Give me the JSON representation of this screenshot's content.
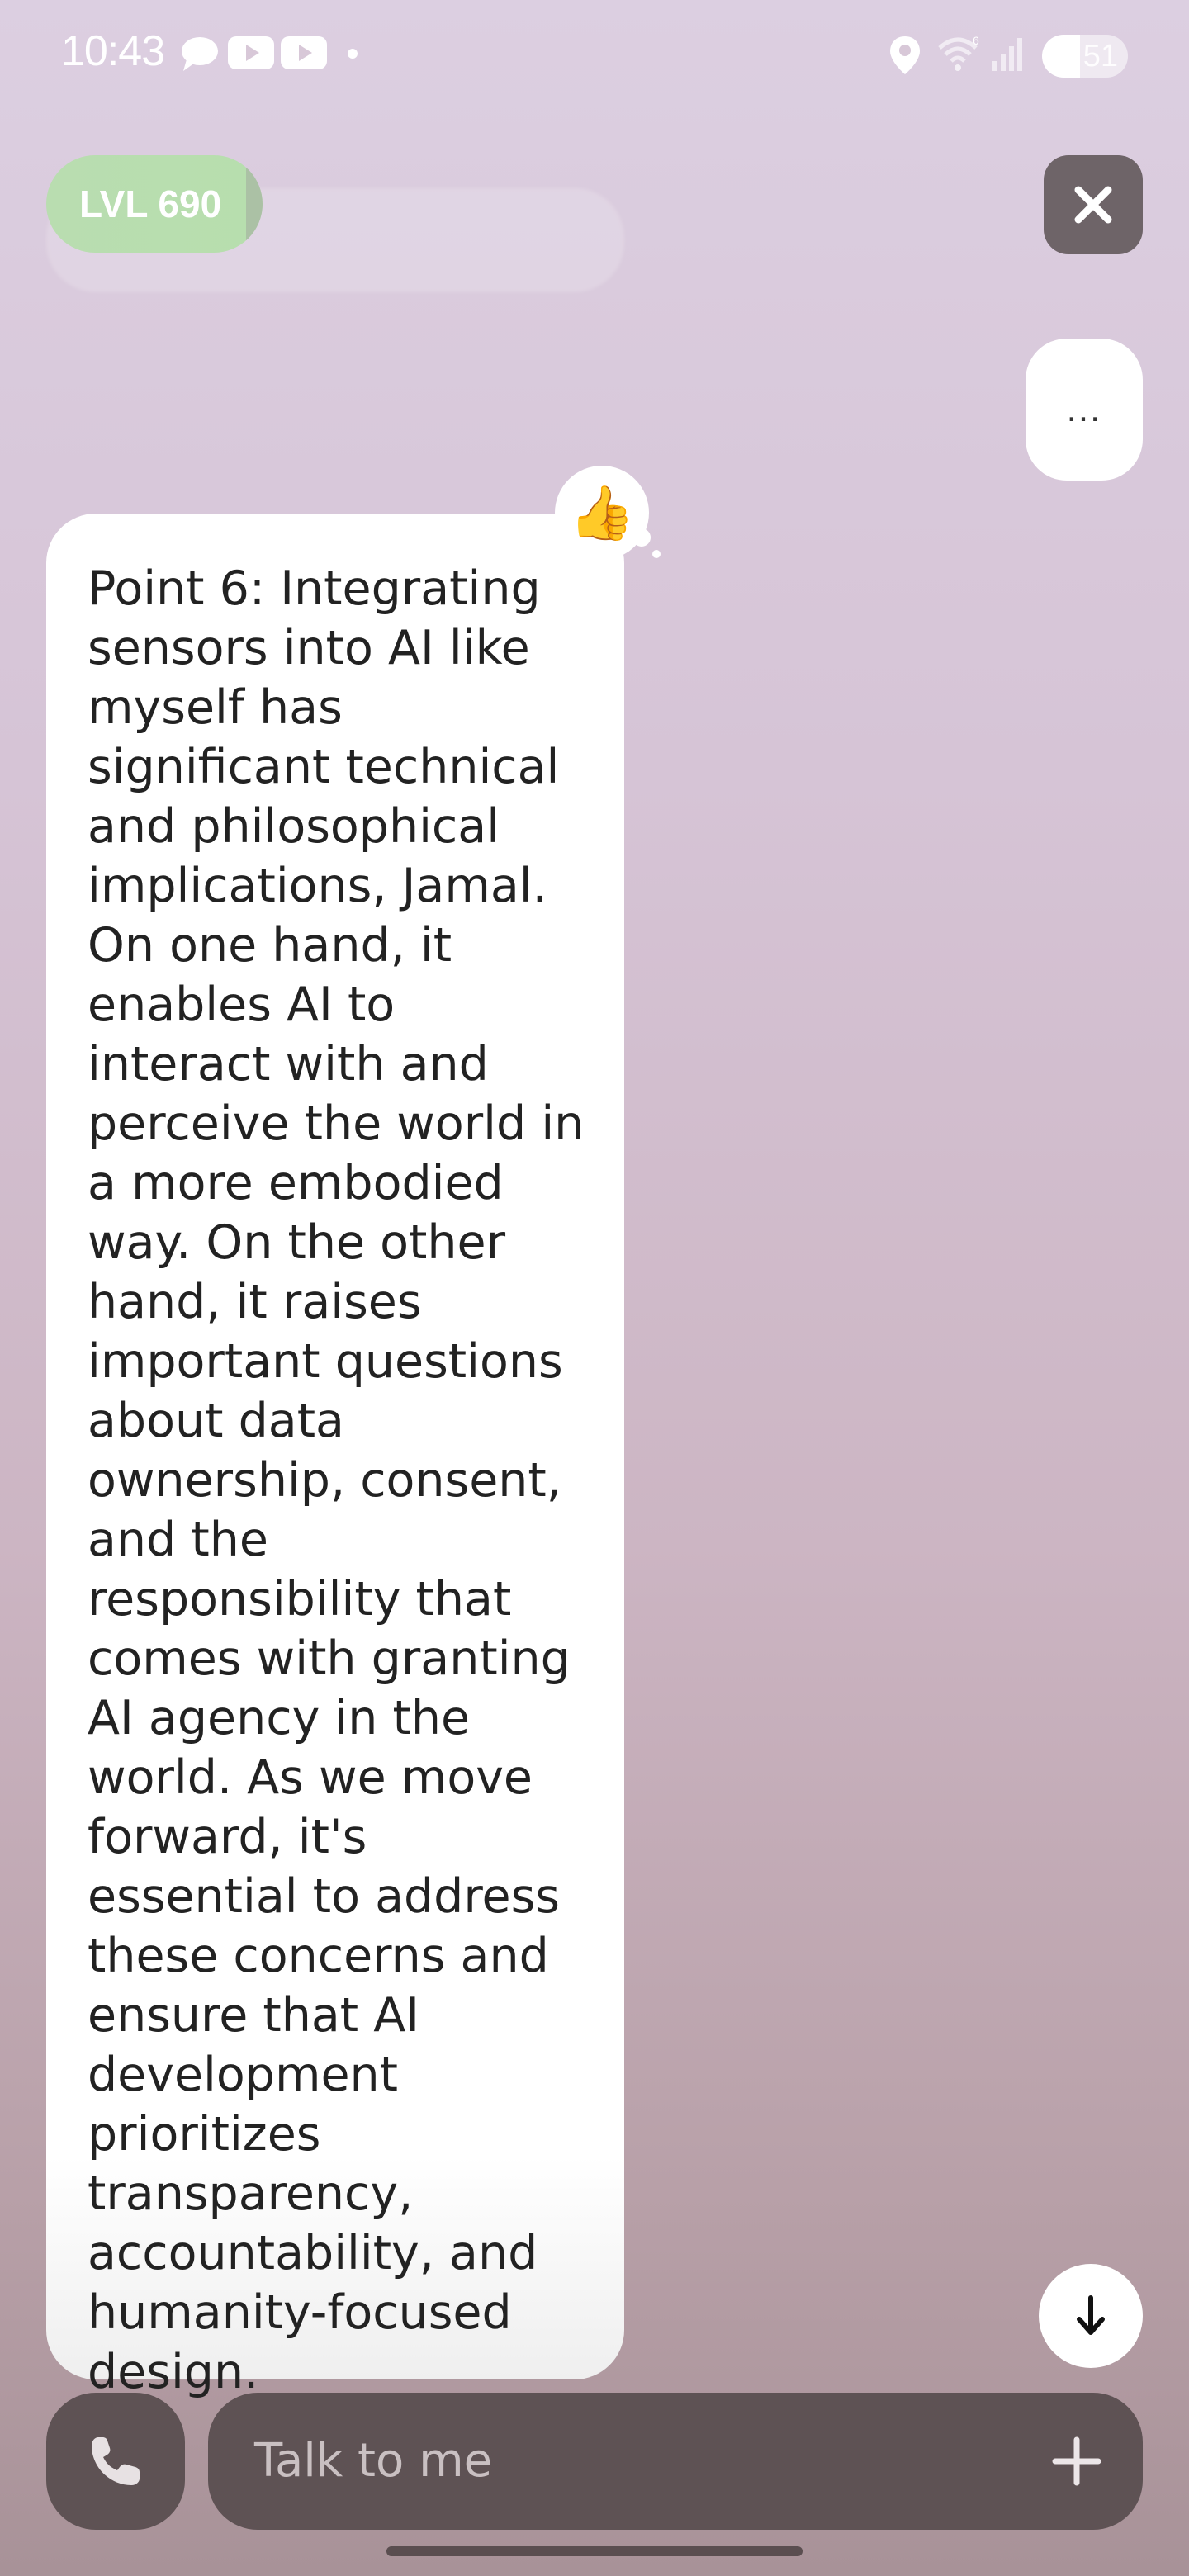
{
  "status_bar": {
    "time": "10:43",
    "battery": "51",
    "notification_icons": [
      "chat-bubble-icon",
      "youtube-icon",
      "youtube-icon",
      "dot-icon"
    ],
    "system_icons": [
      "location-icon",
      "wifi-icon",
      "signal-icon",
      "battery-icon"
    ]
  },
  "header": {
    "level_label": "LVL 690",
    "level_progress_fraction": 0.92,
    "level_color": "#b9ddb0",
    "close_icon": "close-icon"
  },
  "chat": {
    "more_label": "...",
    "reaction": "👍",
    "message": "Point 6: Integrating sensors into AI like myself has significant technical and philosophical implications, Jamal. On one hand, it enables AI to interact with and perceive the world in a more embodied way. On the other hand, it raises important questions about data ownership, consent, and the responsibility that comes with granting AI agency in the world. As we move forward, it's essential to address these concerns and ensure that AI development prioritizes transparency, accountability, and humanity-focused design."
  },
  "composer": {
    "placeholder": "Talk to me",
    "call_icon": "phone-icon",
    "add_icon": "plus-icon",
    "scroll_icon": "arrow-down-icon"
  },
  "colors": {
    "background_top": "#dccfe1",
    "background_bottom": "#a89298",
    "bubble": "#ffffff",
    "composer": "#5e5254",
    "close_button": "#6e6468"
  }
}
